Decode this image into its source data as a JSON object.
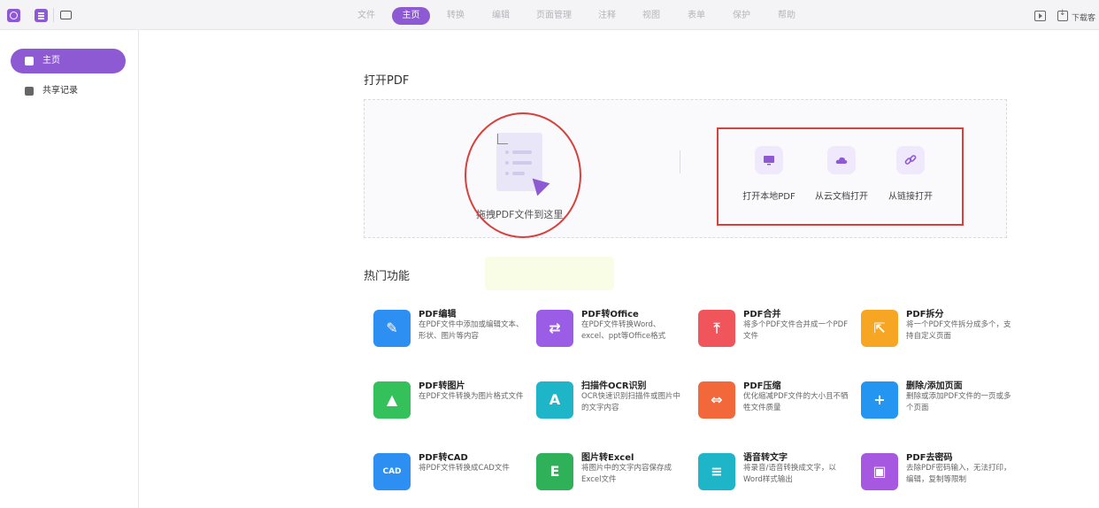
{
  "topnav": {
    "items": [
      {
        "label": "文件"
      },
      {
        "label": "主页",
        "active": true
      },
      {
        "label": "转换"
      },
      {
        "label": "编辑"
      },
      {
        "label": "页面管理"
      },
      {
        "label": "注释"
      },
      {
        "label": "视图"
      },
      {
        "label": "表单"
      },
      {
        "label": "保护"
      },
      {
        "label": "帮助"
      }
    ],
    "right": {
      "download_label": "下载客"
    }
  },
  "sidebar": {
    "items": [
      {
        "label": "主页",
        "icon": "home-icon",
        "active": true
      },
      {
        "label": "共享记录",
        "icon": "document-icon"
      }
    ]
  },
  "open_section": {
    "title": "打开PDF",
    "drop_label": "拖拽PDF文件到这里",
    "options": [
      {
        "label": "打开本地PDF",
        "icon": "monitor-icon"
      },
      {
        "label": "从云文档打开",
        "icon": "cloud-icon"
      },
      {
        "label": "从链接打开",
        "icon": "link-icon"
      }
    ]
  },
  "features_section": {
    "title": "热门功能",
    "items": [
      {
        "title": "PDF编辑",
        "desc": "在PDF文件中添加或编辑文本、形状、图片等内容",
        "icon": "edit-icon",
        "color": "#2e8ff2"
      },
      {
        "title": "PDF转Office",
        "desc": "在PDF文件转换Word、excel、ppt等Office格式",
        "icon": "convert-icon",
        "color": "#9b5de5"
      },
      {
        "title": "PDF合并",
        "desc": "将多个PDF文件合并成一个PDF文件",
        "icon": "merge-icon",
        "color": "#f0555b"
      },
      {
        "title": "PDF拆分",
        "desc": "将一个PDF文件拆分成多个，支持自定义页面",
        "icon": "split-icon",
        "color": "#f6a623"
      },
      {
        "title": "PDF转图片",
        "desc": "在PDF文件转换为图片格式文件",
        "icon": "image-icon",
        "color": "#34c05a"
      },
      {
        "title": "扫描件OCR识别",
        "desc": "OCR快速识别扫描件或图片中的文字内容",
        "icon": "ocr-icon",
        "color": "#1fb5c9"
      },
      {
        "title": "PDF压缩",
        "desc": "优化缩减PDF文件的大小且不牺牲文件质量",
        "icon": "compress-icon",
        "color": "#f2683a"
      },
      {
        "title": "删除/添加页面",
        "desc": "删除或添加PDF文件的一页或多个页面",
        "icon": "add-page-icon",
        "color": "#2495f0"
      },
      {
        "title": "PDF转CAD",
        "desc": "将PDF文件转换成CAD文件",
        "icon": "cad-icon",
        "color": "#2e8ff2"
      },
      {
        "title": "图片转Excel",
        "desc": "将图片中的文字内容保存成Excel文件",
        "icon": "excel-icon",
        "color": "#2fb15a"
      },
      {
        "title": "语音转文字",
        "desc": "将录音/语音转换成文字，以Word样式输出",
        "icon": "voice-icon",
        "color": "#1fb5c9"
      },
      {
        "title": "PDF去密码",
        "desc": "去除PDF密码输入，无法打印，编辑，复制等限制",
        "icon": "unlock-icon",
        "color": "#a659e0"
      }
    ]
  }
}
